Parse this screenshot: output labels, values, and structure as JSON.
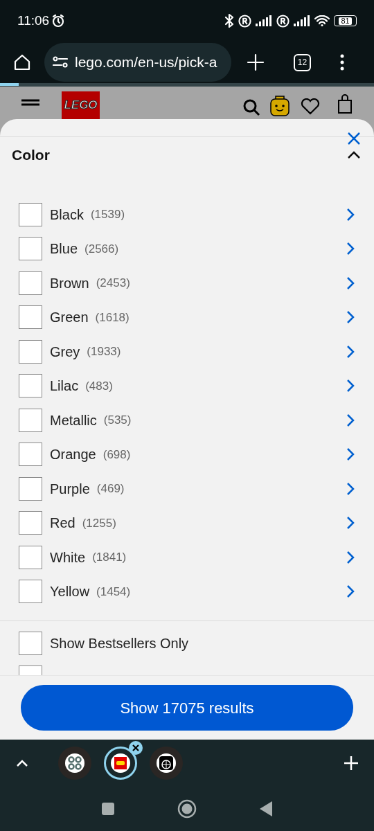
{
  "status_bar": {
    "time": "11:06",
    "battery": "81"
  },
  "browser": {
    "url": "lego.com/en-us/pick-a",
    "tab_count": "12"
  },
  "site_header": {
    "logo": "LEGO"
  },
  "filter": {
    "title": "Color",
    "expanded": true,
    "options": [
      {
        "label": "Black",
        "count": "(1539)",
        "checked": false
      },
      {
        "label": "Blue",
        "count": "(2566)",
        "checked": false
      },
      {
        "label": "Brown",
        "count": "(2453)",
        "checked": false
      },
      {
        "label": "Green",
        "count": "(1618)",
        "checked": false
      },
      {
        "label": "Grey",
        "count": "(1933)",
        "checked": false
      },
      {
        "label": "Lilac",
        "count": "(483)",
        "checked": false
      },
      {
        "label": "Metallic",
        "count": "(535)",
        "checked": false
      },
      {
        "label": "Orange",
        "count": "(698)",
        "checked": false
      },
      {
        "label": "Purple",
        "count": "(469)",
        "checked": false
      },
      {
        "label": "Red",
        "count": "(1255)",
        "checked": false
      },
      {
        "label": "White",
        "count": "(1841)",
        "checked": false
      },
      {
        "label": "Yellow",
        "count": "(1454)",
        "checked": false
      }
    ]
  },
  "extra_options": [
    {
      "label": "Show Bestsellers Only",
      "checked": false
    },
    {
      "checked": false
    }
  ],
  "show_button": "Show 17075 results",
  "tab_strip": [
    {
      "selected": false
    },
    {
      "selected": true
    },
    {
      "selected": false
    }
  ]
}
